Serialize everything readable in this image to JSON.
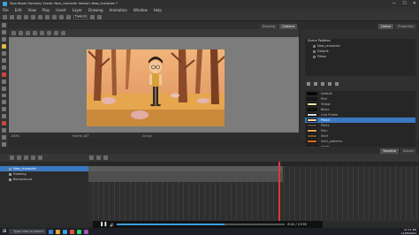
{
  "window": {
    "title": "Toon Boom Harmony Scene: New_character Version: New_character *",
    "controls": [
      "—",
      "☐",
      "✕"
    ]
  },
  "menu": [
    "File",
    "Edit",
    "View",
    "Play",
    "Insert",
    "Layer",
    "Drawing",
    "Animation",
    "Window",
    "Help"
  ],
  "toolbar": {
    "workspace_value": "Default"
  },
  "view_tabs": [
    {
      "label": "Drawing",
      "active": false
    },
    {
      "label": "Camera",
      "active": true
    }
  ],
  "camera_status": {
    "zoom": "100%",
    "frame": "Frame 187",
    "fps": "24 fps"
  },
  "right_panel": {
    "tabs": [
      "Colour",
      "Properties"
    ],
    "palette_list": {
      "header": "Scene Palettes",
      "items": [
        "New_character",
        "Default",
        "Pillow"
      ]
    },
    "swatches": [
      {
        "name": "Default",
        "color": "#000000"
      },
      {
        "name": "Pink",
        "color": "#1a1a1a"
      },
      {
        "name": "Yellow",
        "color": "#f4e4a0"
      },
      {
        "name": "Black",
        "color": "#111111"
      },
      {
        "name": "Line Frame",
        "color": "#dcdcdc"
      },
      {
        "name": "Peach",
        "color": "#ffd7a8"
      },
      {
        "name": "Pants",
        "color": "#5c4a3a"
      },
      {
        "name": "Skin",
        "color": "#e9a857"
      },
      {
        "name": "Shirt",
        "color": "#7a5a2c"
      },
      {
        "name": "shirt_patterns",
        "color": "#d96a2a"
      },
      {
        "name": "pants",
        "color": "#3a2a22"
      },
      {
        "name": "shoe",
        "color": "#8a5a2a"
      }
    ],
    "selected_swatch": 5
  },
  "timeline": {
    "tabs": [
      "Timeline",
      "Xsheet"
    ],
    "layers": [
      {
        "name": "New_character",
        "selected": true
      },
      {
        "name": "Drawing",
        "selected": false
      },
      {
        "name": "Background",
        "selected": false
      }
    ],
    "current_frame": 187
  },
  "player": {
    "progress": 0.64,
    "time": "8:42 / 13:36"
  },
  "taskbar": {
    "search_placeholder": "Type here to search",
    "time": "11:11 PM",
    "date": "11/08/2021",
    "lang": "ENG"
  },
  "colors": {
    "accent": "#3b78c2",
    "playhead": "#d93a3a",
    "sky": "#f0b47a"
  }
}
